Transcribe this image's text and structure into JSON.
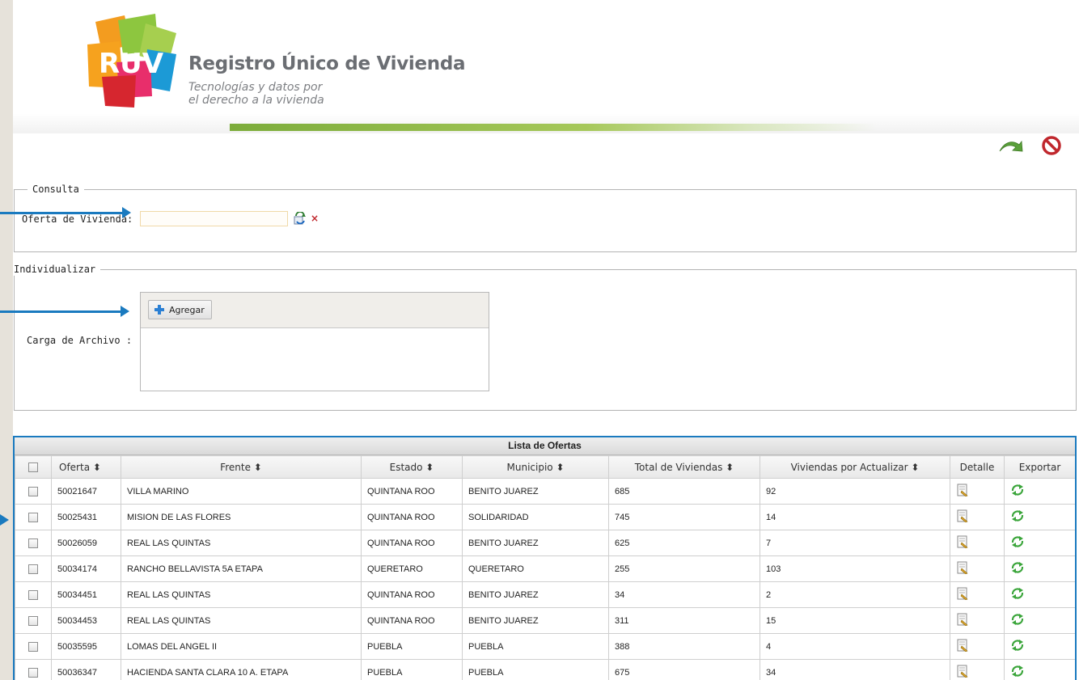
{
  "brand": {
    "logo_text": "RUV",
    "title": "Registro Único de Vivienda",
    "tagline_1": "Tecnologías y datos por",
    "tagline_2": "el derecho a la vivienda"
  },
  "toolbar": {
    "back_icon": "back-arrow-icon",
    "cancel_icon": "cancel-icon"
  },
  "consulta": {
    "legend": "Consulta",
    "field_label": "Oferta de Vivienda:",
    "field_value": "",
    "clear_label": "×"
  },
  "individualizar": {
    "legend": "Individualizar",
    "upload_label": "Carga de Archivo :",
    "add_button": "Agregar"
  },
  "table": {
    "caption": "Lista de Ofertas",
    "headers": {
      "oferta": "Oferta ⬍",
      "frente": "Frente ⬍",
      "estado": "Estado ⬍",
      "municipio": "Municipio ⬍",
      "total": "Total de Viviendas ⬍",
      "por_actualizar": "Viviendas por Actualizar ⬍",
      "detalle": "Detalle",
      "exportar": "Exportar"
    },
    "rows": [
      {
        "oferta": "50021647",
        "frente": "VILLA MARINO",
        "estado": "QUINTANA ROO",
        "municipio": "BENITO JUAREZ",
        "total": "685",
        "por_actualizar": "92"
      },
      {
        "oferta": "50025431",
        "frente": "MISION DE LAS FLORES",
        "estado": "QUINTANA ROO",
        "municipio": "SOLIDARIDAD",
        "total": "745",
        "por_actualizar": "14"
      },
      {
        "oferta": "50026059",
        "frente": "REAL LAS QUINTAS",
        "estado": "QUINTANA ROO",
        "municipio": "BENITO JUAREZ",
        "total": "625",
        "por_actualizar": "7"
      },
      {
        "oferta": "50034174",
        "frente": "RANCHO BELLAVISTA 5A ETAPA",
        "estado": "QUERETARO",
        "municipio": "QUERETARO",
        "total": "255",
        "por_actualizar": "103"
      },
      {
        "oferta": "50034451",
        "frente": "REAL LAS QUINTAS",
        "estado": "QUINTANA ROO",
        "municipio": "BENITO JUAREZ",
        "total": "34",
        "por_actualizar": "2"
      },
      {
        "oferta": "50034453",
        "frente": "REAL LAS QUINTAS",
        "estado": "QUINTANA ROO",
        "municipio": "BENITO JUAREZ",
        "total": "311",
        "por_actualizar": "15"
      },
      {
        "oferta": "50035595",
        "frente": "LOMAS DEL ANGEL II",
        "estado": "PUEBLA",
        "municipio": "PUEBLA",
        "total": "388",
        "por_actualizar": "4"
      },
      {
        "oferta": "50036347",
        "frente": "HACIENDA SANTA CLARA 10 A. ETAPA",
        "estado": "PUEBLA",
        "municipio": "PUEBLA",
        "total": "675",
        "por_actualizar": "34"
      }
    ]
  },
  "colors": {
    "annotation_blue": "#1a7abf",
    "green_bar": "#7cac3b",
    "cancel_red": "#c0272d"
  }
}
